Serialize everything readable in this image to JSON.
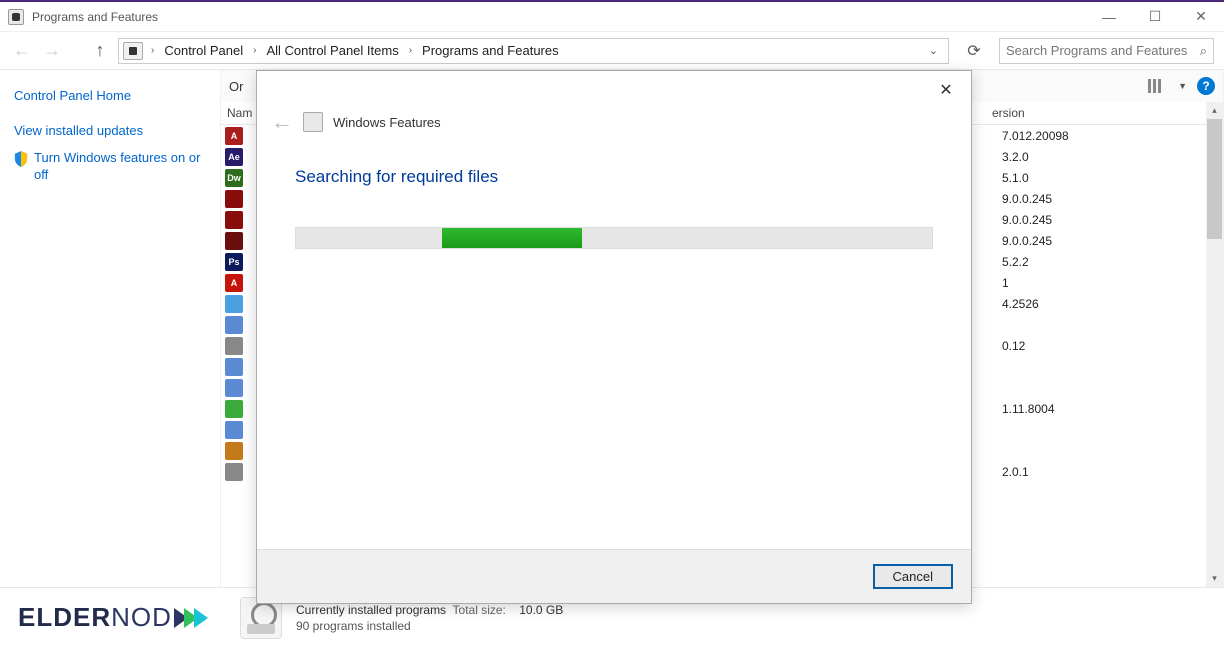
{
  "window": {
    "title": "Programs and Features",
    "minimize": "—",
    "maximize": "☐",
    "close": "✕"
  },
  "breadcrumb": {
    "items": [
      "Control Panel",
      "All Control Panel Items",
      "Programs and Features"
    ],
    "chevron": "›"
  },
  "navbar": {
    "refresh": "⟳",
    "dropdown": "⌄"
  },
  "search": {
    "placeholder": "Search Programs and Features",
    "icon": "🔍"
  },
  "sidebar": {
    "home": "Control Panel Home",
    "updates": "View installed updates",
    "features": "Turn Windows features on or off"
  },
  "toolbar": {
    "organize_partial": "Or",
    "dropdown": "▼",
    "help": "?"
  },
  "columns": {
    "name_partial": "Nam",
    "version_partial": "ersion"
  },
  "rows": [
    {
      "icon_bg": "#a91e1e",
      "icon_txt": "A",
      "version": "7.012.20098"
    },
    {
      "icon_bg": "#2a1a6a",
      "icon_txt": "Ae",
      "version": "3.2.0"
    },
    {
      "icon_bg": "#2e6b1a",
      "icon_txt": "Dw",
      "version": "5.1.0"
    },
    {
      "icon_bg": "#8a0d0d",
      "icon_txt": "",
      "version": "9.0.0.245"
    },
    {
      "icon_bg": "#8a0d0d",
      "icon_txt": "",
      "version": "9.0.0.245"
    },
    {
      "icon_bg": "#6a0d0d",
      "icon_txt": "",
      "version": "9.0.0.245"
    },
    {
      "icon_bg": "#0a1a5a",
      "icon_txt": "Ps",
      "version": "5.2.2"
    },
    {
      "icon_bg": "#c4140c",
      "icon_txt": "A",
      "version": "1"
    },
    {
      "icon_bg": "#4aa0e0",
      "icon_txt": "",
      "version": "4.2526"
    },
    {
      "icon_bg": "#5a8ad4",
      "icon_txt": "",
      "version": ""
    },
    {
      "icon_bg": "#888888",
      "icon_txt": "",
      "version": "0.12"
    },
    {
      "icon_bg": "#5a8ad4",
      "icon_txt": "",
      "version": ""
    },
    {
      "icon_bg": "#5a8ad4",
      "icon_txt": "",
      "version": ""
    },
    {
      "icon_bg": "#3aaa3a",
      "icon_txt": "",
      "version": "1.11.8004"
    },
    {
      "icon_bg": "#5a8ad4",
      "icon_txt": "",
      "version": ""
    },
    {
      "icon_bg": "#c47a1a",
      "icon_txt": "",
      "version": ""
    },
    {
      "icon_bg": "#888888",
      "icon_txt": "",
      "version": "2.0.1"
    }
  ],
  "status": {
    "title": "Currently installed programs",
    "size_label": "Total size:",
    "size_value": "10.0 GB",
    "count": "90 programs installed"
  },
  "logo": {
    "text1": "ELDER",
    "text2": "NOD"
  },
  "modal": {
    "close": "✕",
    "back": "←",
    "title": "Windows Features",
    "heading": "Searching for required files",
    "cancel": "Cancel"
  }
}
